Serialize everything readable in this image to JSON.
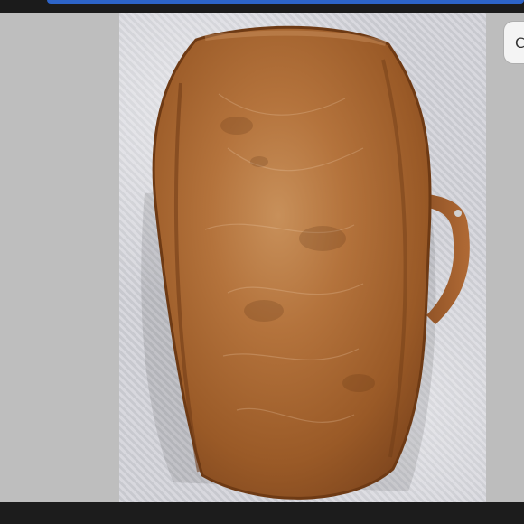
{
  "viewer": {
    "side_button_glyph": "C"
  },
  "photo": {
    "subject_icon": "leather-bag-image",
    "colors": {
      "leather": "#a86530",
      "leather_highlight": "#c8905a",
      "fur": "#d3d4da",
      "bar": "#1b1b1b",
      "accent": "#2d64c8"
    }
  }
}
